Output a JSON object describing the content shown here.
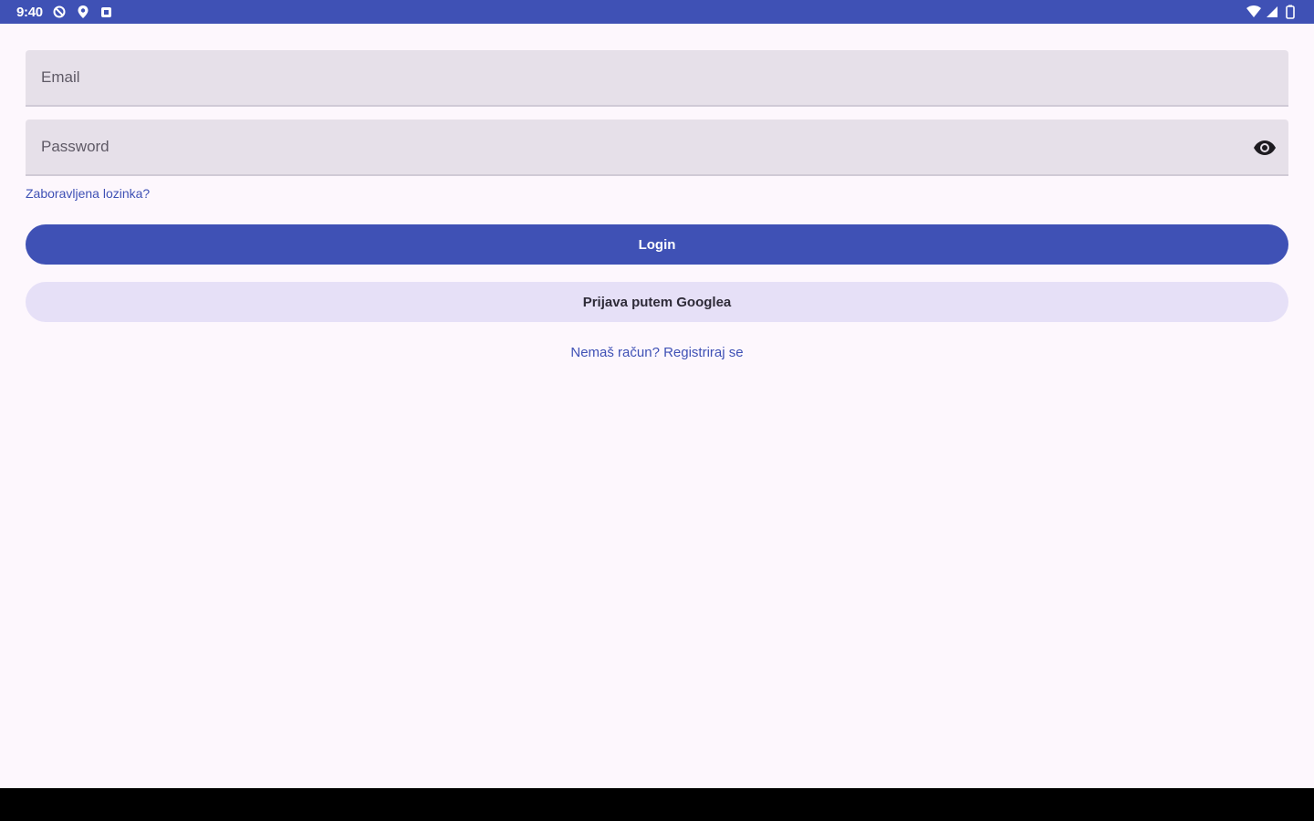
{
  "status_bar": {
    "time": "9:40",
    "left_icons": [
      "do-not-disturb-icon",
      "location-icon",
      "notification-icon"
    ],
    "right_icons": [
      "wifi-icon",
      "signal-icon",
      "battery-icon"
    ],
    "background_color": "#3f51b5"
  },
  "form": {
    "email": {
      "placeholder": "Email",
      "value": ""
    },
    "password": {
      "placeholder": "Password",
      "value": "",
      "toggle_icon": "eye-icon"
    },
    "forgot_password_label": "Zaboravljena lozinka?",
    "login_label": "Login",
    "google_login_label": "Prijava putem Googlea",
    "register_label": "Nemaš račun? Registriraj se"
  },
  "colors": {
    "primary": "#3f51b5",
    "background": "#fdf7fd",
    "field_background": "#e6e0e9",
    "secondary_button": "#e6e0f7"
  }
}
